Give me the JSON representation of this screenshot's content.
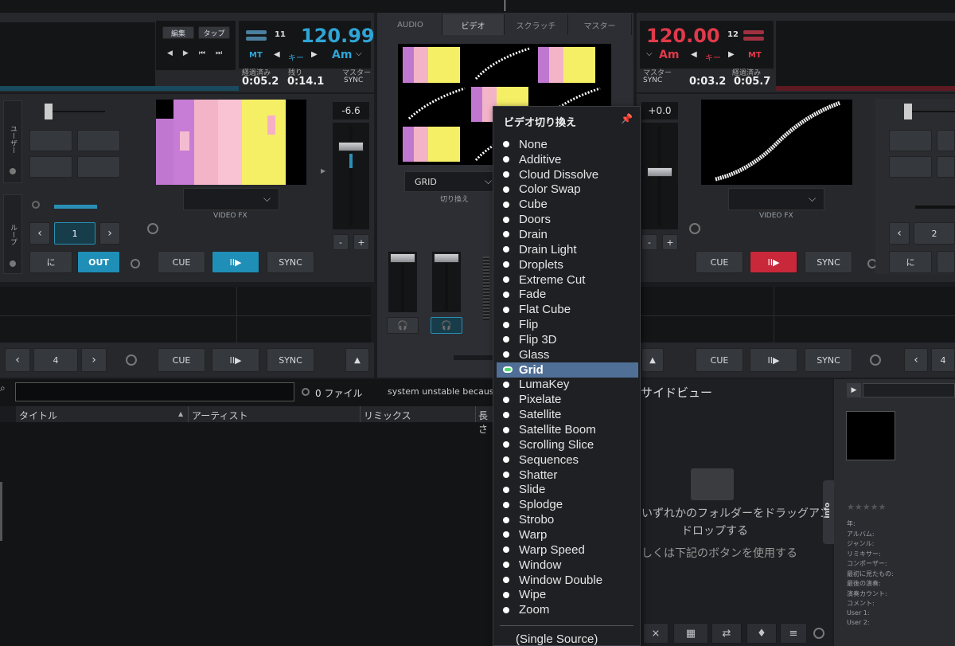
{
  "deck_left": {
    "edit_label": "編集",
    "tap_label": "タップ",
    "key_number": "11",
    "bpm": "120.99",
    "mt_label": "MT",
    "key_label": "キー",
    "key_value": "Am",
    "elapsed_label": "経過済み",
    "remain_label": "残り",
    "master_label": "マスター",
    "elapsed": "0:05.2",
    "remain": "0:14.1",
    "sync_small": "SYNC",
    "pitch": "-6.6",
    "user_label": "ユーザー",
    "loop_label": "ループ",
    "loop_value": "1",
    "in_label": "に",
    "out_label": "OUT",
    "cue": "CUE",
    "play": "II▶",
    "sync": "SYNC",
    "videofx": "VIDEO FX",
    "minus": "-",
    "plus": "+",
    "lower_loop": "4",
    "lower_cue": "CUE",
    "lower_play": "II▶",
    "lower_sync": "SYNC"
  },
  "center": {
    "tabs": [
      "AUDIO",
      "ビデオ",
      "スクラッチ",
      "マスター"
    ],
    "transition_value": "GRID",
    "transition_label": "切り換え"
  },
  "deck_right": {
    "bpm": "120.00",
    "key_number": "12",
    "key_value": "Am",
    "key_label": "キー",
    "mt_label": "MT",
    "master_label": "マスター",
    "sync_small": "SYNC",
    "elapsed_label": "経過済み",
    "elapsed": "0:05.7",
    "remain": "0:03.2",
    "pitch": "+0.0",
    "cue": "CUE",
    "play": "II▶",
    "sync": "SYNC",
    "videofx": "VIDEO FX",
    "minus": "-",
    "plus": "+",
    "loop_value": "2",
    "in_label": "に",
    "lower_cue": "CUE",
    "lower_play": "II▶",
    "lower_sync": "SYNC",
    "lower_loop": "4"
  },
  "browser": {
    "search_placeholder": "",
    "file_count": "0 ファイル",
    "status": "system unstable becaus",
    "columns": [
      "タイトル",
      "アーティスト",
      "リミックス",
      "長さ"
    ],
    "sideview_title": "サイドビュー",
    "drop_text_1": "いずれかのフォルダーをドラッグアンド",
    "drop_text_2": "ドロップする",
    "drop_text_3": "しくは下記のボタンを使用する",
    "info_tab": "info"
  },
  "info_panel": {
    "fields": [
      "年:",
      "アルバム:",
      "ジャンル:",
      "リミキサー:",
      "コンポーザー:",
      "最初に見たもの:",
      "最後の演奏:",
      "演奏カウント:",
      "コメント:",
      "User 1:",
      "User 2:"
    ]
  },
  "menu": {
    "title": "ビデオ切り換え",
    "items": [
      "None",
      "Additive",
      "Cloud Dissolve",
      "Color Swap",
      "Cube",
      "Doors",
      "Drain",
      "Drain Light",
      "Droplets",
      "Extreme Cut",
      "Fade",
      "Flat Cube",
      "Flip",
      "Flip 3D",
      "Glass",
      "Grid",
      "LumaKey",
      "Pixelate",
      "Satellite",
      "Satellite Boom",
      "Scrolling Slice",
      "Sequences",
      "Shatter",
      "Slide",
      "Splodge",
      "Strobo",
      "Warp",
      "Warp Speed",
      "Window",
      "Window Double",
      "Wipe",
      "Zoom"
    ],
    "selected": "Grid",
    "footer_item": "(Single Source)"
  },
  "colors": {
    "accent_blue": "#1f8fb8",
    "accent_red": "#c8283a",
    "selected_row": "#4f6f96"
  }
}
